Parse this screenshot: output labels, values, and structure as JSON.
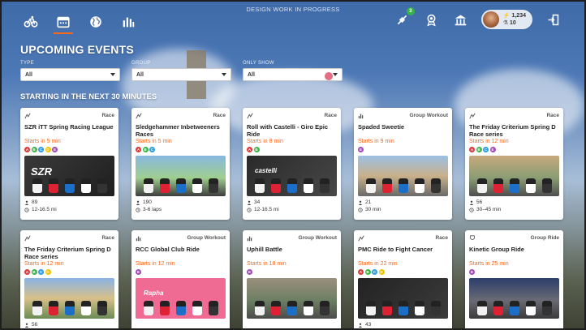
{
  "banner": "DESIGN WORK IN PROGRESS",
  "nav": [
    {
      "icon": "bike-icon",
      "active": false
    },
    {
      "icon": "calendar-icon",
      "active": true
    },
    {
      "icon": "globe-icon",
      "active": false
    },
    {
      "icon": "stats-icon",
      "active": false
    }
  ],
  "topright": {
    "notifications_count": "3",
    "profile": {
      "level": "1,234",
      "drops": "10"
    }
  },
  "page_title": "UPCOMING EVENTS",
  "filters": {
    "type": {
      "label": "TYPE",
      "value": "All"
    },
    "group": {
      "label": "GROUP",
      "value": "All"
    },
    "only_show": {
      "label": "ONLY SHOW",
      "value": "All"
    }
  },
  "section_title": "STARTING IN THE NEXT 30 MINUTES",
  "events": [
    {
      "type": "Race",
      "title": "SZR iTT Spring Racing League",
      "starts": "Starts in 5 min",
      "cats": [
        "A",
        "B",
        "C",
        "D",
        "E"
      ],
      "thumb": "SZR",
      "riders": "89",
      "detail": "12-16.5 mi"
    },
    {
      "type": "Race",
      "title": "Sledgehammer Inbetweeners Races",
      "starts": "Starts in 5 min",
      "cats": [
        "A",
        "B",
        "C"
      ],
      "thumb": "",
      "riders": "190",
      "detail": "3-6 laps"
    },
    {
      "type": "Race",
      "title": "Roll with Castelli - Giro Epic Ride",
      "starts": "Starts in 8 min",
      "cats": [
        "A",
        "B"
      ],
      "thumb": "castelli",
      "riders": "34",
      "detail": "12-16.5 mi"
    },
    {
      "type": "Group Workout",
      "title": "Spaded Sweetie",
      "starts": "Starts in 9 min",
      "cats": [
        "E"
      ],
      "thumb": "",
      "riders": "21",
      "detail": "30 min"
    },
    {
      "type": "Race",
      "title": "The Friday Criterium Spring D Race series",
      "starts": "Starts in 12 min",
      "cats": [
        "A",
        "B",
        "C",
        "E"
      ],
      "thumb": "",
      "riders": "56",
      "detail": "30–45 min"
    },
    {
      "type": "Race",
      "title": "The Friday Criterium Spring D Race series",
      "starts": "Starts in 12 min",
      "cats": [
        "A",
        "B",
        "C",
        "D"
      ],
      "thumb": "",
      "riders": "56",
      "detail": ""
    },
    {
      "type": "Group Workout",
      "title": "RCC Global Club Ride",
      "starts": "Starts in 12 min",
      "cats": [
        "E"
      ],
      "thumb": "Rapha",
      "riders": "",
      "detail": ""
    },
    {
      "type": "Group Workout",
      "title": "Uphill Battle",
      "starts": "Starts in 18 min",
      "cats": [
        "E"
      ],
      "thumb": "",
      "riders": "",
      "detail": ""
    },
    {
      "type": "Race",
      "title": "PMC Ride to Fight Cancer",
      "starts": "Starts in 22 min",
      "cats": [
        "A",
        "B",
        "C",
        "D"
      ],
      "thumb": "",
      "riders": "43",
      "detail": ""
    },
    {
      "type": "Group Ride",
      "title": "Kinetic Group Ride",
      "starts": "Starts in 25 min",
      "cats": [
        "E"
      ],
      "thumb": "",
      "riders": "",
      "detail": ""
    }
  ]
}
